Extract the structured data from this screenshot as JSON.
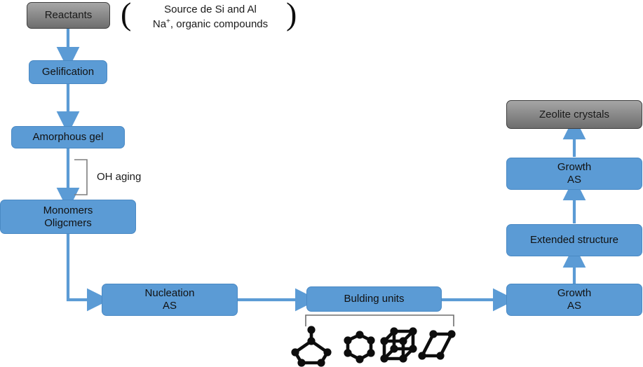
{
  "diagram": {
    "title": "Zeolite crystallization pathway flowchart",
    "colors": {
      "box_blue": "#5B9BD5",
      "box_blue_border": "#4A89C4",
      "box_gray_top": "#A6A6A6",
      "box_gray_bottom": "#6E6E6E",
      "arrow_blue": "#5B9BD5",
      "bracket_gray": "#7F7F7F",
      "molecule_black": "#0D0D0D",
      "text": "#1A1A1A",
      "background": "#FFFFFF"
    }
  },
  "nodes": {
    "reactants": {
      "label": "Reactants",
      "style": "gray"
    },
    "gelification": {
      "label": "Gelification",
      "style": "blue"
    },
    "amorphous_gel": {
      "label": "Amorphous gel",
      "style": "blue"
    },
    "monomers": {
      "line1": "Monomers",
      "line2": "Oligcmers",
      "style": "blue"
    },
    "nucleation": {
      "line1": "Nucleation",
      "line2": "AS",
      "style": "blue"
    },
    "building_units": {
      "label": "Bulding units",
      "style": "blue"
    },
    "growth_bottom": {
      "line1": "Growth",
      "line2": "AS",
      "style": "blue"
    },
    "extended_structure": {
      "label": "Extended structure",
      "style": "blue"
    },
    "growth_top": {
      "line1": "Growth",
      "line2": "AS",
      "style": "blue"
    },
    "zeolite_crystals": {
      "label": "Zeolite crystals",
      "style": "gray"
    }
  },
  "annotations": {
    "reactant_detail_line1": "Source de Si and Al",
    "reactant_detail_line2_base": "Na",
    "reactant_detail_line2_sup": "+",
    "reactant_detail_line2_rest": ", organic compounds",
    "paren_open": "(",
    "paren_close": ")",
    "oh_aging": "OH aging"
  },
  "molecules": [
    {
      "name": "pentagon-with-stem-molecule",
      "vertices": 5
    },
    {
      "name": "hexagon-ring-molecule",
      "vertices": 6
    },
    {
      "name": "cube-cage-molecule",
      "vertices": 8
    },
    {
      "name": "parallelogram-molecule",
      "vertices": 4
    }
  ],
  "flow_edges": [
    {
      "from": "reactants",
      "to": "gelification",
      "direction": "down"
    },
    {
      "from": "gelification",
      "to": "amorphous_gel",
      "direction": "down"
    },
    {
      "from": "amorphous_gel",
      "to": "monomers",
      "direction": "down"
    },
    {
      "from": "monomers",
      "to": "nucleation",
      "direction": "down-right-elbow"
    },
    {
      "from": "nucleation",
      "to": "building_units",
      "direction": "right"
    },
    {
      "from": "building_units",
      "to": "growth_bottom",
      "direction": "right"
    },
    {
      "from": "growth_bottom",
      "to": "extended_structure",
      "direction": "up"
    },
    {
      "from": "extended_structure",
      "to": "growth_top",
      "direction": "up"
    },
    {
      "from": "growth_top",
      "to": "zeolite_crystals",
      "direction": "up"
    }
  ]
}
